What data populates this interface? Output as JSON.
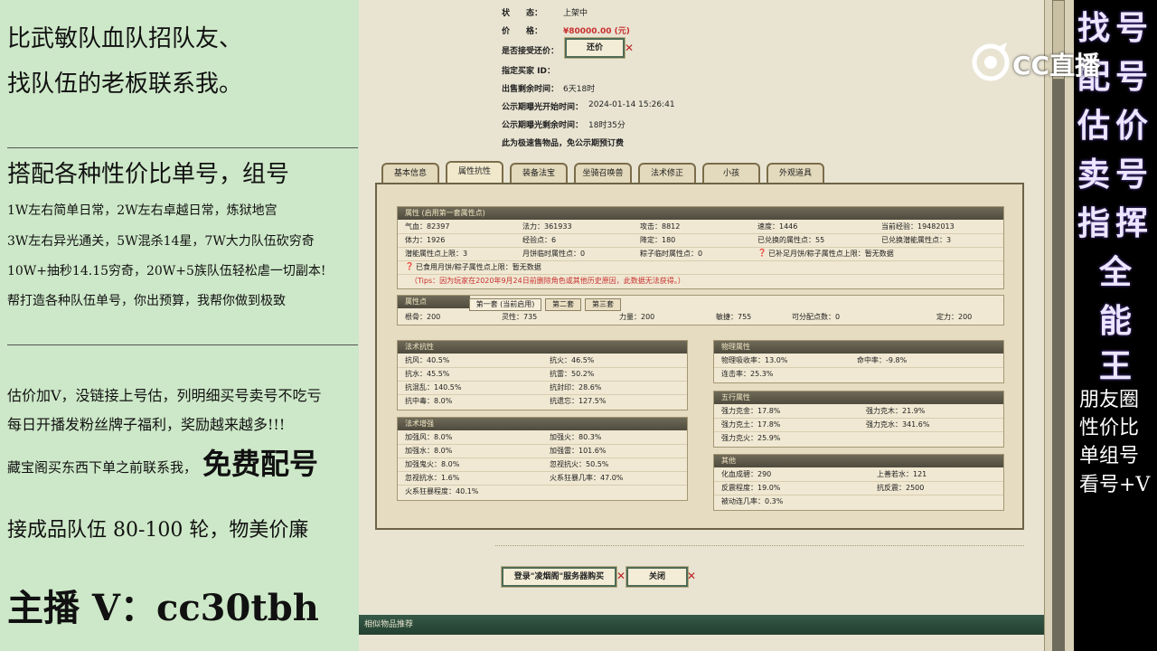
{
  "left": {
    "line1": "比武敏队血队招队友、",
    "line2": "找队伍的老板联系我。",
    "heading2": "搭配各种性价比单号，组号",
    "p1": "1W左右简单日常，2W左右卓越日常，炼狱地宫",
    "p2": "3W左右异光通关，5W混杀14星，7W大力队伍砍穷奇",
    "p3": "10W+抽秒14.15穷奇，20W+5族队伍轻松虐一切副本!",
    "p4": "帮打造各种队伍单号，你出预算，我帮你做到极致",
    "p5": "估价加V，没链接上号估，列明细买号卖号不吃亏",
    "p6": "每日开播发粉丝牌子福利，奖励越来越多!!!",
    "p7a": "藏宝阁买东西下单之前联系我，",
    "p7b": "免费配号",
    "p8": "接成品队伍 80-100 轮，物美价廉",
    "p9": "主播 V：cc30tbh"
  },
  "right": {
    "col1": [
      "找",
      "配",
      "估",
      "卖",
      "指"
    ],
    "col2": [
      "号",
      "号",
      "价",
      "号",
      "挥"
    ],
    "center": [
      "全",
      "能",
      "王"
    ],
    "lines": [
      "朋友圈",
      "性价比",
      "单组号",
      "看号+V"
    ]
  },
  "logo": {
    "text": "CC直播"
  },
  "info": {
    "status_label": "状　　态：",
    "status_value": "上架中",
    "price_label": "价　　格：",
    "price_value": "¥80000.00 (元)",
    "bargain_label": "是否接受还价：",
    "bargain_button": "还价",
    "buyer_label": "指定买家 ID：",
    "buyer_value": "",
    "remaining_label": "出售剩余时间：",
    "remaining_value": "6天18时",
    "publicity_start_label": "公示期曝光开始时间：",
    "publicity_start_value": "2024-01-14 15:26:41",
    "publicity_remaining_label": "公示期曝光剩余时间：",
    "publicity_remaining_value": "18时35分",
    "fast_sale_note": "此为极速售物品，免公示期预订费"
  },
  "tabs": [
    "基本信息",
    "属性抗性",
    "装备法宝",
    "坐骑召唤兽",
    "法术修正",
    "小孩",
    "外观道具"
  ],
  "attributes": {
    "header": "属性 (启用第一套属性点)",
    "rows": [
      [
        "气血：82397",
        "法力：361933",
        "攻击：8812",
        "速度：1446",
        "当前经验：19482013"
      ],
      [
        "体力：1926",
        "经验点：6",
        "降定：180",
        "已兑换的属性点：55",
        "已兑换潜能属性点：3"
      ],
      [
        "潜能属性点上限：3",
        "月饼临时属性点：0",
        "粽子临时属性点：0",
        "",
        ""
      ]
    ],
    "note1": "已食用月饼/粽子属性点上限：暂无数据",
    "note1b": "已补足月饼/粽子属性点上限：暂无数据",
    "tips": "（Tips：因为玩家在2020年9月24日前删除角色或其他历史原因，此数据无法获得。）"
  },
  "points": {
    "header": "属性点",
    "subtabs": [
      "第一套 (当前启用)",
      "第二套",
      "第三套"
    ],
    "row": [
      "根骨：200",
      "灵性：735",
      "力量：200",
      "敏捷：755",
      "可分配点数：0",
      "定力：200"
    ]
  },
  "magic_resist": {
    "header": "法术抗性",
    "rows": [
      [
        "抗风：40.5%",
        "抗火：46.5%"
      ],
      [
        "抗水：45.5%",
        "抗雷：50.2%"
      ],
      [
        "抗混乱：140.5%",
        "抗封印：28.6%"
      ],
      [
        "抗中毒：8.0%",
        "抗遗忘：127.5%"
      ]
    ]
  },
  "magic_boost": {
    "header": "法术增强",
    "rows": [
      [
        "加强风：8.0%",
        "加强火：80.3%"
      ],
      [
        "加强水：8.0%",
        "加强雷：101.6%"
      ],
      [
        "加强鬼火：8.0%",
        "忽视抗火：50.5%"
      ],
      [
        "忽视抗水：1.6%",
        "火系狂暴几率：47.0%"
      ],
      [
        "火系狂暴程度：40.1%",
        ""
      ]
    ]
  },
  "physical": {
    "header": "物理属性",
    "rows": [
      [
        "物理吸收率：13.0%",
        "命中率：-9.8%"
      ],
      [
        "连击率：25.3%",
        ""
      ]
    ]
  },
  "five_elements": {
    "header": "五行属性",
    "rows": [
      [
        "强力克金：17.8%",
        "强力克木：21.9%"
      ],
      [
        "强力克土：17.8%",
        "强力克水：341.6%"
      ],
      [
        "强力克火：25.9%",
        ""
      ]
    ]
  },
  "other": {
    "header": "其他",
    "rows": [
      [
        "化血成碧：290",
        "上善若水：121"
      ],
      [
        "反震程度：19.0%",
        "抗反震：2500"
      ],
      [
        "被动连几率：0.3%",
        ""
      ]
    ]
  },
  "buttons": {
    "login_buy": "登录\"凌烟阁\"服务器购买",
    "close": "关闭"
  },
  "related": {
    "label": "相似物品推荐"
  },
  "colors": {
    "left_bg": "#cde8c8",
    "price_red": "#c83030",
    "header_green": "#365948",
    "right_text": "#ece6ff"
  }
}
